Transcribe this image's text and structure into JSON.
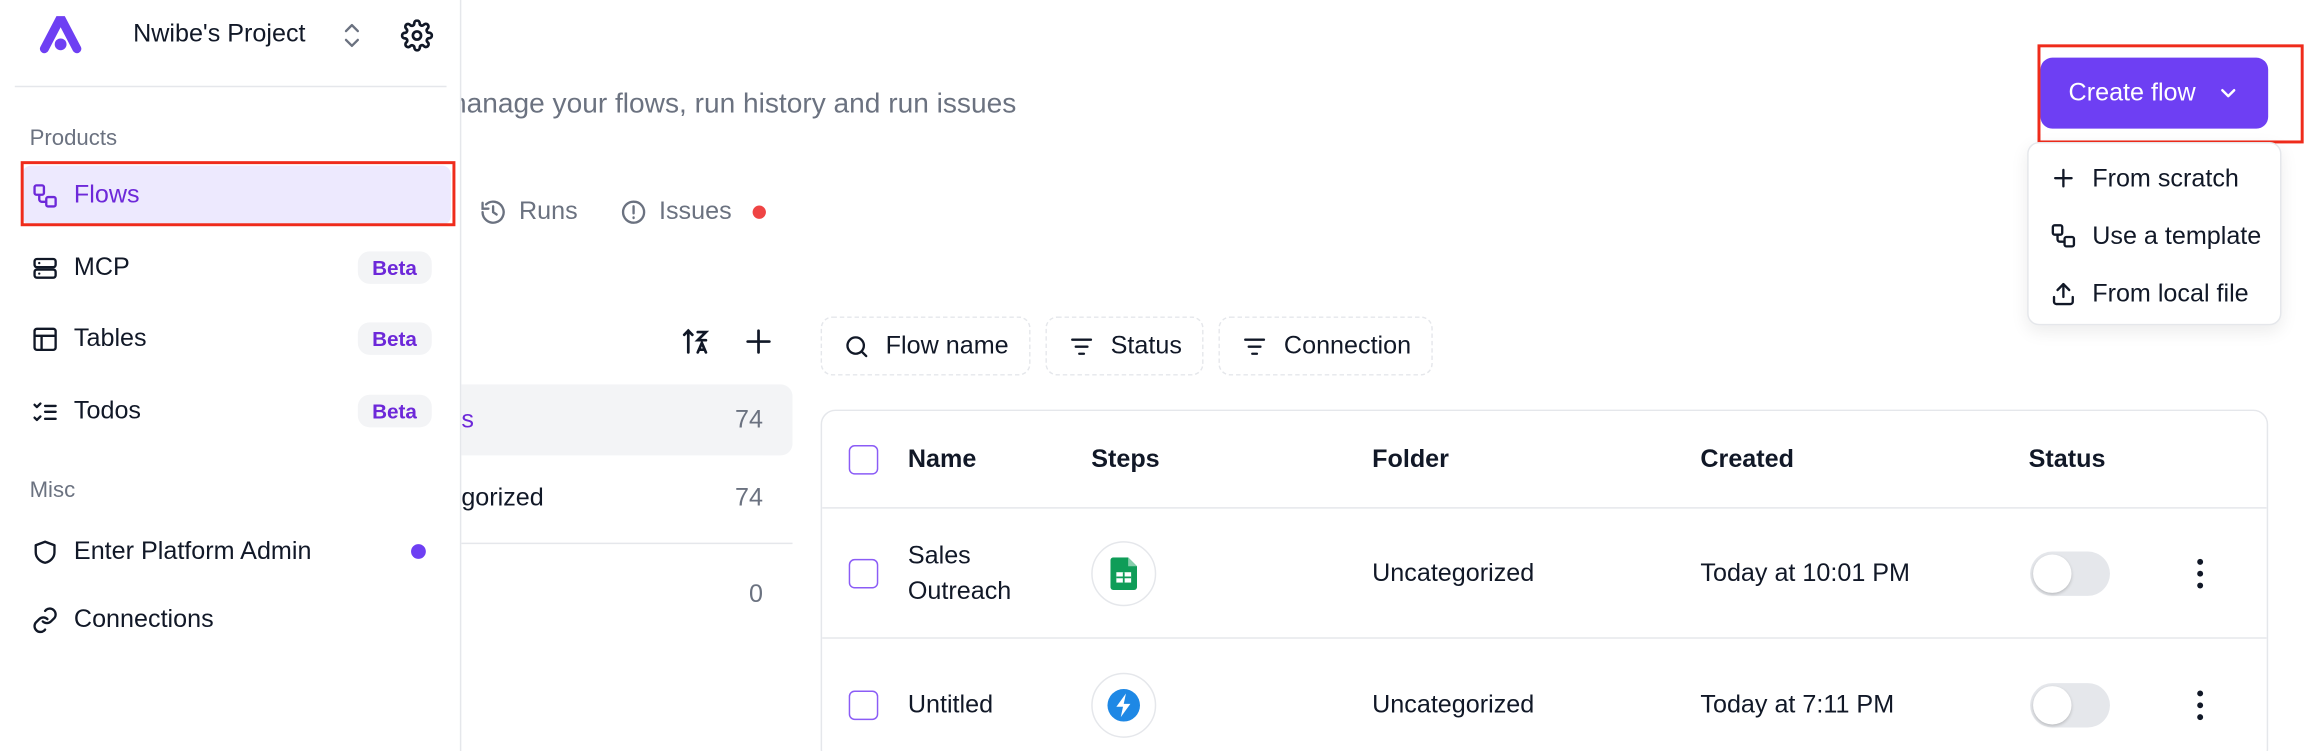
{
  "sidebar": {
    "project_name": "Nwibe's Project",
    "products_label": "Products",
    "misc_label": "Misc",
    "items": [
      {
        "label": "Flows"
      },
      {
        "label": "MCP",
        "badge": "Beta"
      },
      {
        "label": "Tables",
        "badge": "Beta"
      },
      {
        "label": "Todos",
        "badge": "Beta"
      },
      {
        "label": "Enter Platform Admin"
      },
      {
        "label": "Connections"
      }
    ]
  },
  "header": {
    "subtitle": "nanage your flows, run history and run issues",
    "create_flow_label": "Create flow",
    "create_menu": [
      "From scratch",
      "Use a template",
      "From local file"
    ]
  },
  "tabs": [
    "Runs",
    "Issues"
  ],
  "folders": [
    {
      "label": "s",
      "count": "74"
    },
    {
      "label": "gorized",
      "count": "74"
    },
    {
      "label": "",
      "count": "0"
    }
  ],
  "filters": [
    "Flow name",
    "Status",
    "Connection"
  ],
  "table": {
    "columns": [
      "Name",
      "Steps",
      "Folder",
      "Created",
      "Status"
    ],
    "rows": [
      {
        "name_line1": "Sales",
        "name_line2": "Outreach",
        "folder": "Uncategorized",
        "created": "Today at 10:01 PM"
      },
      {
        "name_line1": "Untitled",
        "name_line2": "",
        "folder": "Uncategorized",
        "created": "Today at 7:11 PM"
      }
    ]
  },
  "colors": {
    "accent": "#6e3ff3",
    "highlight_box": "#ef2b1b",
    "issue_dot": "#ef4444"
  }
}
